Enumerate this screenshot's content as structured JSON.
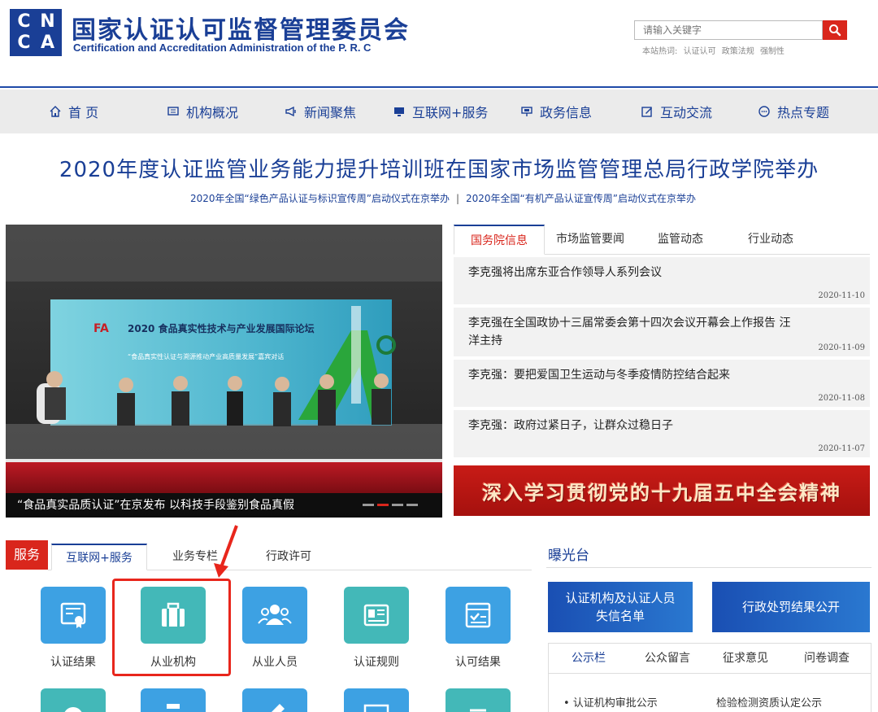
{
  "header": {
    "logo_letters": [
      "C",
      "N",
      "C",
      "A"
    ],
    "title_cn": "国家认证认可监督管理委员会",
    "title_en": "Certification and Accreditation Administration of the P. R. C",
    "search_placeholder": "请输入关键字",
    "hot_words_label": "本站热词:",
    "hot_words": [
      "认证认可",
      "政策法规",
      "强制性"
    ]
  },
  "nav": {
    "items": [
      {
        "label": "首 页",
        "icon": "home-icon"
      },
      {
        "label": "机构概况",
        "icon": "monitor-icon"
      },
      {
        "label": "新闻聚焦",
        "icon": "megaphone-icon"
      },
      {
        "label": "互联网+服务",
        "icon": "screen-icon"
      },
      {
        "label": "政务信息",
        "icon": "sign-icon"
      },
      {
        "label": "互动交流",
        "icon": "edit-icon"
      },
      {
        "label": "热点专题",
        "icon": "chat-icon"
      }
    ]
  },
  "headline": {
    "main": "2020年度认证监管业务能力提升培训班在国家市场监管管理总局行政学院举办",
    "sub1": "2020年全国“绿色产品认证与标识宣传周”启动仪式在京举办",
    "separator": "|",
    "sub2": "2020年全国“有机产品认证宣传周”启动仪式在京举办"
  },
  "slider": {
    "caption": "“食品真实品质认证”在京发布 以科技手段鉴别食品真假",
    "scene_title": "2020 食品真实性技术与产业发展国际论坛",
    "scene_subtitle": "“食品真实性认证与溯源推动产业高质量发展”嘉宾对话",
    "scene_logo": "FA"
  },
  "news": {
    "tabs": [
      "国务院信息",
      "市场监管要闻",
      "监管动态",
      "行业动态"
    ],
    "items": [
      {
        "title": "李克强将出席东亚合作领导人系列会议",
        "date": "2020-11-10"
      },
      {
        "title": "李克强在全国政协十三届常委会第十四次会议开幕会上作报告 汪洋主持",
        "date": "2020-11-09"
      },
      {
        "title": "李克强：要把爱国卫生运动与冬季疫情防控结合起来",
        "date": "2020-11-08"
      },
      {
        "title": "李克强：政府过紧日子，让群众过稳日子",
        "date": "2020-11-07"
      }
    ],
    "banner": "深入学习贯彻党的十九届五中全会精神"
  },
  "service": {
    "label": "服务",
    "tabs": [
      "互联网+服务",
      "业务专栏",
      "行政许可"
    ],
    "items": [
      {
        "name": "认证结果",
        "icon": "certificate-icon"
      },
      {
        "name": "从业机构",
        "icon": "briefcase-icon"
      },
      {
        "name": "从业人员",
        "icon": "people-icon"
      },
      {
        "name": "认证规则",
        "icon": "id-card-icon"
      },
      {
        "name": "认可结果",
        "icon": "checklist-icon"
      }
    ]
  },
  "exposure": {
    "title": "曝光台",
    "banner1_line1": "认证机构及认证人员",
    "banner1_line2": "失信名单",
    "banner2": "行政处罚结果公开",
    "tabs": [
      "公示栏",
      "公众留言",
      "征求意见",
      "问卷调查"
    ],
    "list": [
      "• 认证机构审批公示",
      "检验检测资质认定公示"
    ]
  },
  "colors": {
    "brand_blue": "#1a3f96",
    "accent_red": "#d9261c",
    "icon_blue": "#3da1e3",
    "icon_teal": "#43b8b8"
  }
}
